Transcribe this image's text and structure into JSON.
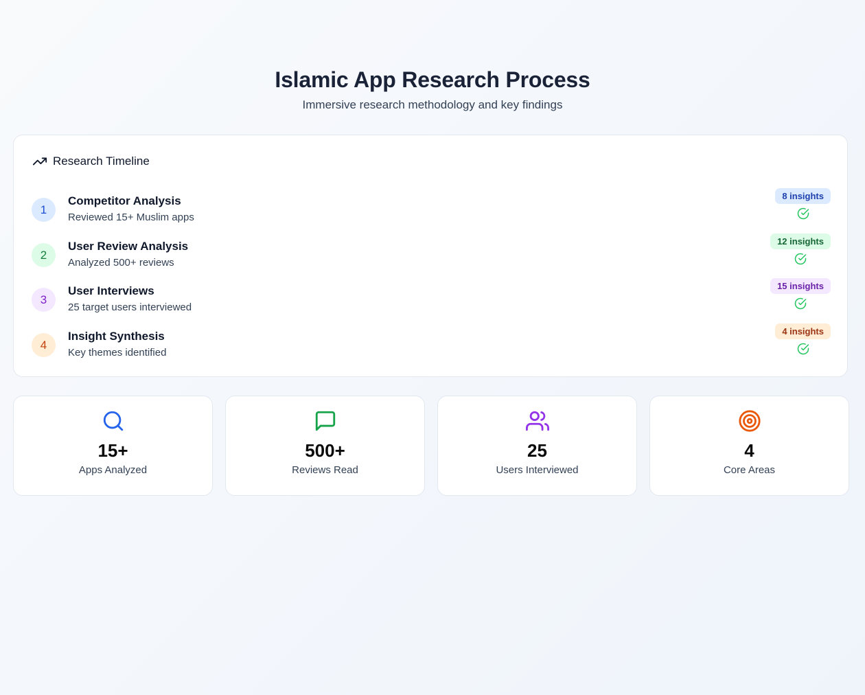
{
  "header": {
    "title": "Islamic App Research Process",
    "subtitle": "Immersive research methodology and key findings"
  },
  "timeline": {
    "title": "Research Timeline",
    "icon": "trending-up-icon",
    "steps": [
      {
        "number": "1",
        "title": "Competitor Analysis",
        "description": "Reviewed 15+ Muslim apps",
        "badge": "8 insights",
        "badge_bg": "#dbeafe",
        "badge_color": "#1e40af",
        "circle_bg": "#dbeafe",
        "circle_color": "#1d4ed8",
        "status_icon": "check-circle-icon"
      },
      {
        "number": "2",
        "title": "User Review Analysis",
        "description": "Analyzed 500+ reviews",
        "badge": "12 insights",
        "badge_bg": "#dcfce7",
        "badge_color": "#166534",
        "circle_bg": "#dcfce7",
        "circle_color": "#15803d",
        "status_icon": "check-circle-icon"
      },
      {
        "number": "3",
        "title": "User Interviews",
        "description": "25 target users interviewed",
        "badge": "15 insights",
        "badge_bg": "#f3e8ff",
        "badge_color": "#6b21a8",
        "circle_bg": "#f3e8ff",
        "circle_color": "#7e22ce",
        "status_icon": "check-circle-icon"
      },
      {
        "number": "4",
        "title": "Insight Synthesis",
        "description": "Key themes identified",
        "badge": "4 insights",
        "badge_bg": "#ffedd5",
        "badge_color": "#9a3412",
        "circle_bg": "#ffedd5",
        "circle_color": "#c2410c",
        "status_icon": "check-circle-icon"
      }
    ]
  },
  "stats": [
    {
      "icon": "search-icon",
      "value": "15+",
      "label": "Apps Analyzed",
      "color": "#2563eb"
    },
    {
      "icon": "message-square-icon",
      "value": "500+",
      "label": "Reviews Read",
      "color": "#16a34a"
    },
    {
      "icon": "users-icon",
      "value": "25",
      "label": "Users Interviewed",
      "color": "#9333ea"
    },
    {
      "icon": "target-icon",
      "value": "4",
      "label": "Core Areas",
      "color": "#ea580c"
    }
  ],
  "colors": {
    "check": "#22c55e",
    "title": "#1a2238",
    "border": "#e2e8f0"
  }
}
